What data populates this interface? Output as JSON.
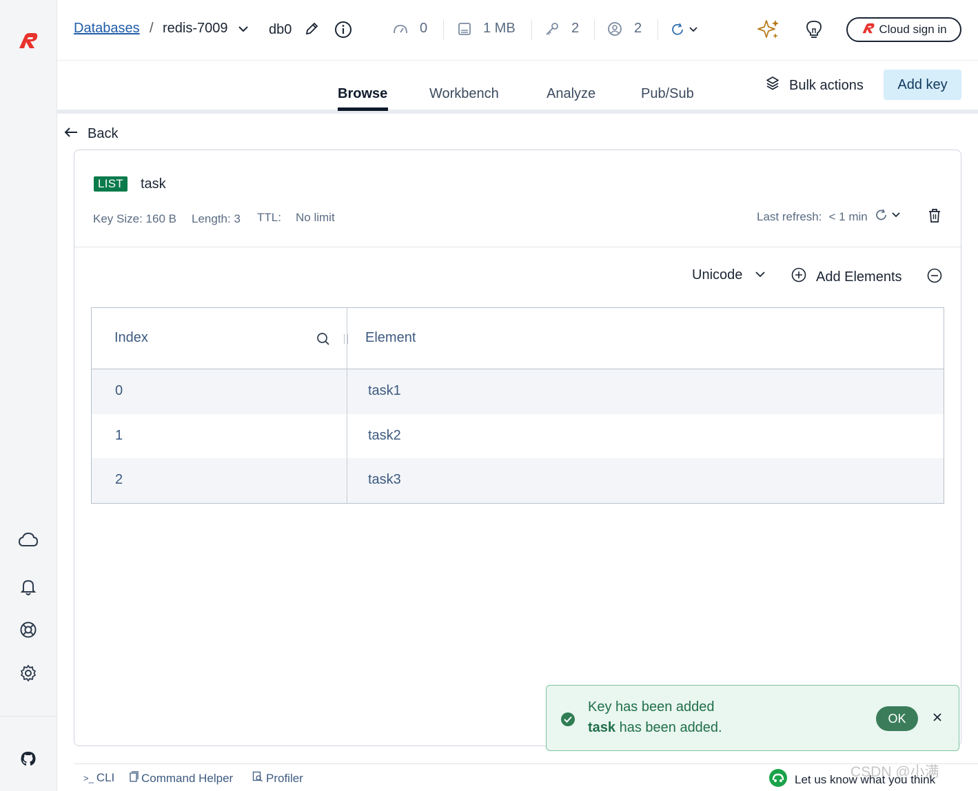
{
  "header": {
    "breadcrumb_link": "Databases",
    "breadcrumb_sep": "/",
    "database_name": "redis-7009",
    "db_index": "db0",
    "stats": {
      "ops": "0",
      "memory": "1 MB",
      "keys": "2",
      "clients": "2"
    },
    "cloud_sign_in": "Cloud sign in"
  },
  "tabs": [
    {
      "label": "Browse",
      "active": true
    },
    {
      "label": "Workbench",
      "active": false
    },
    {
      "label": "Analyze",
      "active": false
    },
    {
      "label": "Pub/Sub",
      "active": false
    }
  ],
  "toolbar": {
    "bulk_actions": "Bulk actions",
    "add_key": "Add key"
  },
  "back_label": "Back",
  "key": {
    "type": "LIST",
    "name": "task",
    "size": "Key Size: 160 B",
    "length": "Length: 3",
    "ttl_label": "TTL:",
    "ttl_value": "No limit",
    "last_refresh_label": "Last refresh:",
    "last_refresh_value": "< 1 min",
    "format": "Unicode",
    "add_elements": "Add Elements"
  },
  "table": {
    "columns": [
      "Index",
      "Element"
    ],
    "rows": [
      {
        "index": "0",
        "element": "task1"
      },
      {
        "index": "1",
        "element": "task2"
      },
      {
        "index": "2",
        "element": "task3"
      }
    ]
  },
  "toast": {
    "title": "Key has been added",
    "key_name": "task",
    "message_suffix": " has been added.",
    "ok_label": "OK"
  },
  "bottom": {
    "cli": "CLI",
    "command_helper": "Command Helper",
    "profiler": "Profiler",
    "feedback": "Let us know what you think"
  },
  "watermark": "CSDN @小满",
  "colors": {
    "brand_red": "#e8322c",
    "success_green": "#0a7a4b",
    "link_blue": "#1f5ca8",
    "add_key_bg": "#d6edfa"
  }
}
